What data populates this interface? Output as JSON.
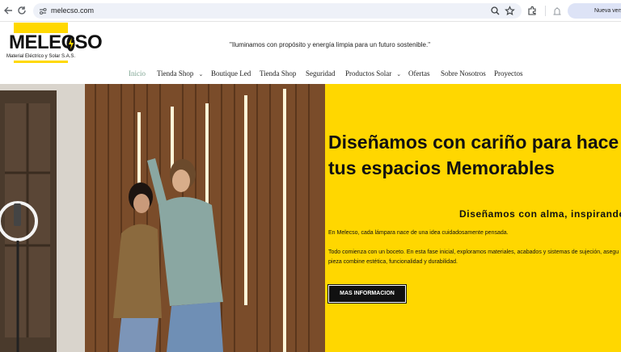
{
  "browser": {
    "url": "melecso.com",
    "update_button": "Nueva versión de Chrome",
    "icons": [
      "back-arrow-icon",
      "reload-icon",
      "site-settings-icon",
      "zoom-icon",
      "bookmark-star-icon",
      "extensions-icon",
      "profile-icon"
    ]
  },
  "site": {
    "logo": {
      "name": "MELECSO",
      "subtitle": "Material Eléctrico y Solar S.A.S."
    },
    "tagline": "\"Iluminamos con propósito y energía limpia para un futuro sostenible.\"",
    "nav": [
      {
        "label": "Inicio",
        "active": true
      },
      {
        "label": "Tienda Shop",
        "dropdown": true
      },
      {
        "label": "Boutique Led"
      },
      {
        "label": "Tienda Shop"
      },
      {
        "label": "Seguridad"
      },
      {
        "label": "Productos Solar",
        "dropdown": true
      },
      {
        "label": "Ofertas"
      },
      {
        "label": "Sobre Nosotros"
      },
      {
        "label": "Proyectos"
      }
    ],
    "colors": {
      "brand_yellow": "#ffd700",
      "active_nav": "#7fa593",
      "text_dark": "#111111"
    }
  },
  "hero": {
    "title_line1": "Diseñamos con cariño para hace",
    "title_line2": "tus espacios Memorables",
    "subtitle": "Diseñamos con alma, inspirando",
    "paragraph1": "En Melecso, cada lámpara nace de una idea cuidadosamente pensada.",
    "paragraph2_line1": "Todo comienza con un boceto. En esta fase inicial, exploramos materiales, acabados y sistemas de sujeción, asegu",
    "paragraph2_line2": "pieza combine estética, funcionalidad y durabilidad.",
    "cta_label": "MAS INFORMACION"
  }
}
